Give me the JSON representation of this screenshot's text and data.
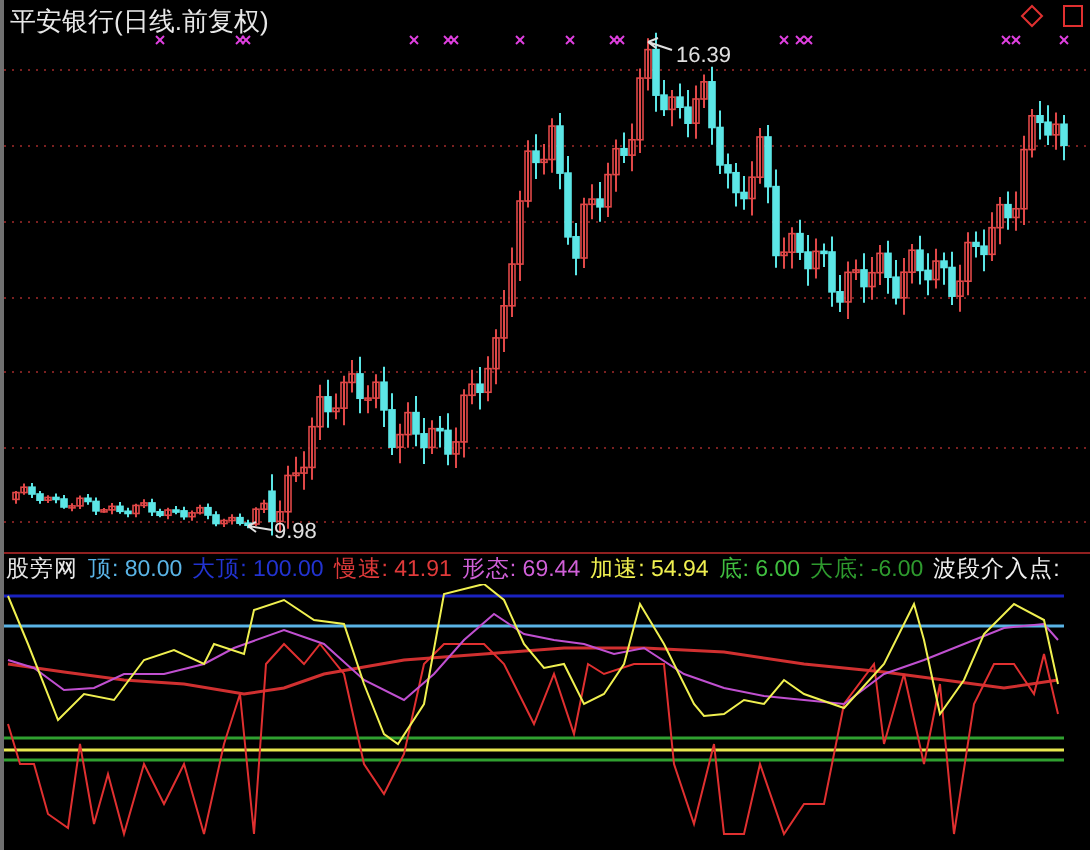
{
  "chart": {
    "title": "平安银行(日线.前复权)",
    "high_label": "16.39",
    "low_label": "9.98"
  },
  "indicator": {
    "legend": [
      {
        "text": "股旁网",
        "color": "#e8e8e8"
      },
      {
        "text": "顶: 80.00",
        "color": "#5ab4e6"
      },
      {
        "text": "大顶: 100.00",
        "color": "#2233d0"
      },
      {
        "text": "慢速: 41.91",
        "color": "#e03a3a"
      },
      {
        "text": "形态: 69.44",
        "color": "#d060d8"
      },
      {
        "text": "加速: 54.94",
        "color": "#f0f050"
      },
      {
        "text": "底: 6.00",
        "color": "#40c040"
      },
      {
        "text": "大底: -6.00",
        "color": "#2e9a2e"
      },
      {
        "text": "波段介入点:",
        "color": "#f0f0f0"
      }
    ]
  }
}
